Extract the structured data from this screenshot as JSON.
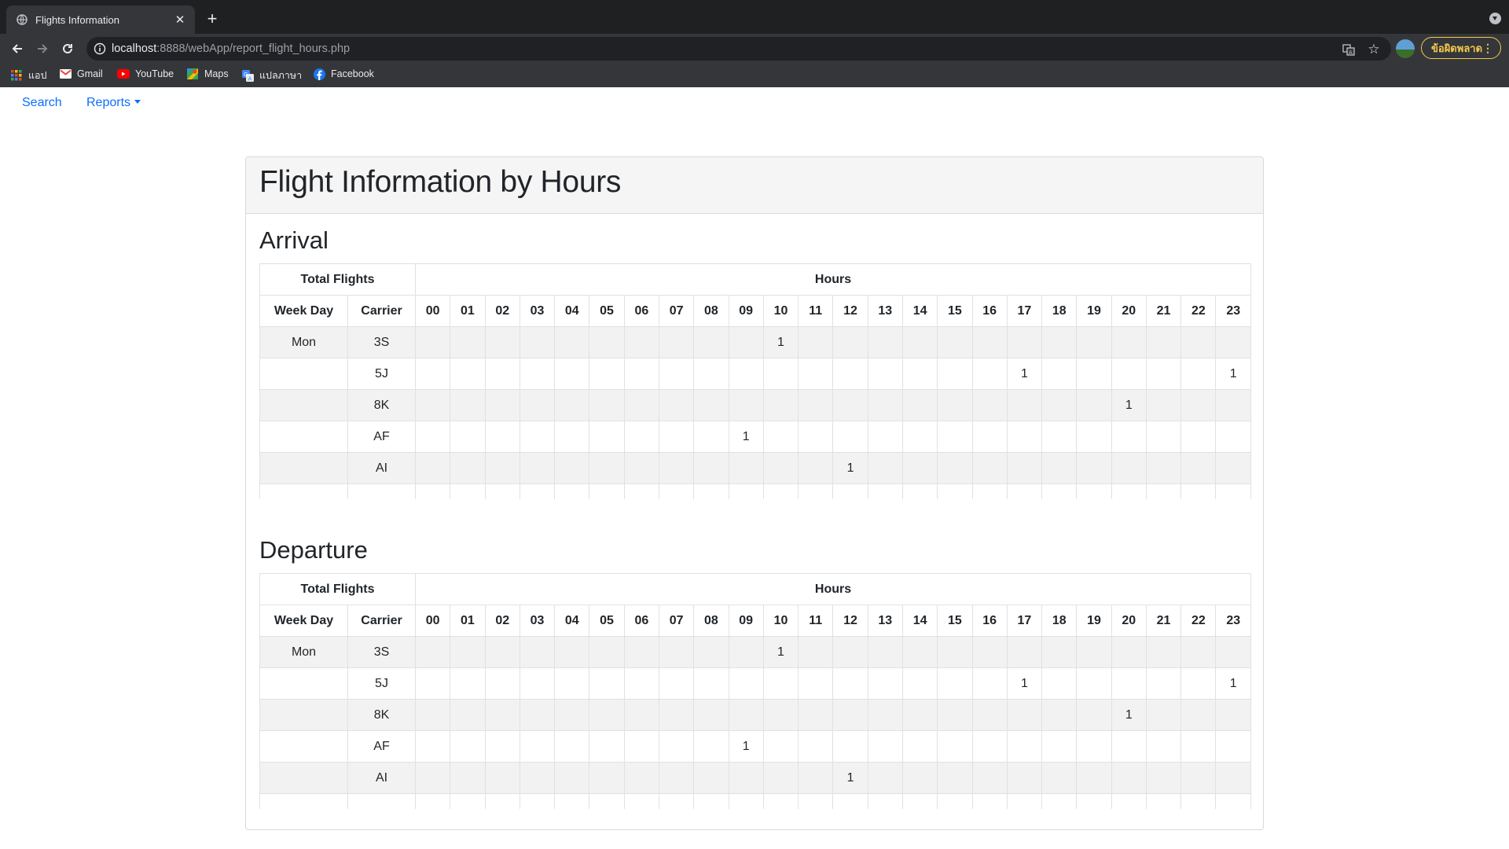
{
  "browser": {
    "tab_title": "Flights Information",
    "url_host": "localhost",
    "url_rest": ":8888/webApp/report_flight_hours.php",
    "error_chip_label": "ข้อผิดพลาด",
    "bookmarks": [
      {
        "label": "แอป",
        "icon": "apps-grid-icon"
      },
      {
        "label": "Gmail",
        "icon": "gmail-icon"
      },
      {
        "label": "YouTube",
        "icon": "youtube-icon"
      },
      {
        "label": "Maps",
        "icon": "maps-icon"
      },
      {
        "label": "แปลภาษา",
        "icon": "translate-icon"
      },
      {
        "label": "Facebook",
        "icon": "facebook-icon"
      }
    ]
  },
  "nav": {
    "search_label": "Search",
    "reports_label": "Reports"
  },
  "card": {
    "title": "Flight Information by Hours"
  },
  "table_headers": {
    "total_flights": "Total Flights",
    "hours": "Hours",
    "week_day": "Week Day",
    "carrier": "Carrier",
    "hour_cols": [
      "00",
      "01",
      "02",
      "03",
      "04",
      "05",
      "06",
      "07",
      "08",
      "09",
      "10",
      "11",
      "12",
      "13",
      "14",
      "15",
      "16",
      "17",
      "18",
      "19",
      "20",
      "21",
      "22",
      "23"
    ]
  },
  "arrival": {
    "title": "Arrival",
    "rows": [
      {
        "day": "Mon",
        "carrier": "3S",
        "hours": [
          "",
          "",
          "",
          "",
          "",
          "",
          "",
          "",
          "",
          "",
          "1",
          "",
          "",
          "",
          "",
          "",
          "",
          "",
          "",
          "",
          "",
          "",
          "",
          ""
        ]
      },
      {
        "day": "",
        "carrier": "5J",
        "hours": [
          "",
          "",
          "",
          "",
          "",
          "",
          "",
          "",
          "",
          "",
          "",
          "",
          "",
          "",
          "",
          "",
          "",
          "1",
          "",
          "",
          "",
          "",
          "",
          "1"
        ]
      },
      {
        "day": "",
        "carrier": "8K",
        "hours": [
          "",
          "",
          "",
          "",
          "",
          "",
          "",
          "",
          "",
          "",
          "",
          "",
          "",
          "",
          "",
          "",
          "",
          "",
          "",
          "",
          "1",
          "",
          "",
          ""
        ]
      },
      {
        "day": "",
        "carrier": "AF",
        "hours": [
          "",
          "",
          "",
          "",
          "",
          "",
          "",
          "",
          "",
          "1",
          "",
          "",
          "",
          "",
          "",
          "",
          "",
          "",
          "",
          "",
          "",
          "",
          "",
          ""
        ]
      },
      {
        "day": "",
        "carrier": "AI",
        "hours": [
          "",
          "",
          "",
          "",
          "",
          "",
          "",
          "",
          "",
          "",
          "",
          "",
          "1",
          "",
          "",
          "",
          "",
          "",
          "",
          "",
          "",
          "",
          "",
          ""
        ]
      },
      {
        "day": "",
        "carrier": "",
        "hours": [
          "",
          "",
          "",
          "",
          "",
          "",
          "",
          "",
          "",
          "",
          "",
          "",
          "",
          "",
          "",
          "",
          "",
          "",
          "",
          "",
          "",
          "",
          "",
          ""
        ]
      }
    ]
  },
  "departure": {
    "title": "Departure",
    "rows": [
      {
        "day": "Mon",
        "carrier": "3S",
        "hours": [
          "",
          "",
          "",
          "",
          "",
          "",
          "",
          "",
          "",
          "",
          "1",
          "",
          "",
          "",
          "",
          "",
          "",
          "",
          "",
          "",
          "",
          "",
          "",
          ""
        ]
      },
      {
        "day": "",
        "carrier": "5J",
        "hours": [
          "",
          "",
          "",
          "",
          "",
          "",
          "",
          "",
          "",
          "",
          "",
          "",
          "",
          "",
          "",
          "",
          "",
          "1",
          "",
          "",
          "",
          "",
          "",
          "1"
        ]
      },
      {
        "day": "",
        "carrier": "8K",
        "hours": [
          "",
          "",
          "",
          "",
          "",
          "",
          "",
          "",
          "",
          "",
          "",
          "",
          "",
          "",
          "",
          "",
          "",
          "",
          "",
          "",
          "1",
          "",
          "",
          ""
        ]
      },
      {
        "day": "",
        "carrier": "AF",
        "hours": [
          "",
          "",
          "",
          "",
          "",
          "",
          "",
          "",
          "",
          "1",
          "",
          "",
          "",
          "",
          "",
          "",
          "",
          "",
          "",
          "",
          "",
          "",
          "",
          ""
        ]
      },
      {
        "day": "",
        "carrier": "AI",
        "hours": [
          "",
          "",
          "",
          "",
          "",
          "",
          "",
          "",
          "",
          "",
          "",
          "",
          "1",
          "",
          "",
          "",
          "",
          "",
          "",
          "",
          "",
          "",
          "",
          ""
        ]
      },
      {
        "day": "",
        "carrier": "",
        "hours": [
          "",
          "",
          "",
          "",
          "",
          "",
          "",
          "",
          "",
          "",
          "",
          "",
          "",
          "",
          "",
          "",
          "",
          "",
          "",
          "",
          "",
          "",
          "",
          ""
        ]
      }
    ]
  }
}
